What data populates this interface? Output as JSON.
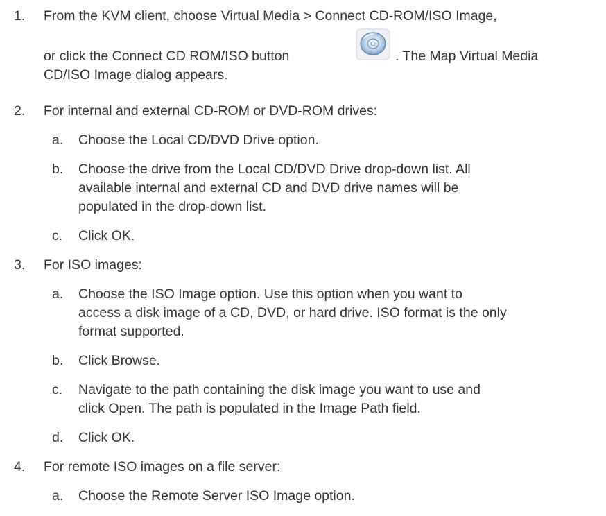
{
  "steps": [
    {
      "num": "1.",
      "line1": "From the KVM client, choose Virtual Media > Connect CD-ROM/ISO Image,",
      "line2": "or click the Connect CD ROM/ISO button",
      "line2_after": ". The Map Virtual Media",
      "line3": "CD/ISO Image dialog appears.",
      "icon": "cd-disc-icon"
    },
    {
      "num": "2.",
      "text": "For internal and external CD-ROM or DVD-ROM drives:",
      "subs": [
        {
          "letter": "a.",
          "lines": [
            "Choose the Local CD/DVD Drive option."
          ]
        },
        {
          "letter": "b.",
          "lines": [
            "Choose the drive from the Local CD/DVD Drive drop-down list. All",
            "available internal and external CD and DVD drive names will be",
            "populated in the drop-down list."
          ]
        },
        {
          "letter": "c.",
          "lines": [
            "Click OK."
          ]
        }
      ]
    },
    {
      "num": "3.",
      "text": "For ISO images:",
      "subs": [
        {
          "letter": "a.",
          "lines": [
            "Choose the ISO Image option. Use this option when you want to",
            "access a disk image of a CD, DVD, or hard drive. ISO format is the only",
            "format supported."
          ]
        },
        {
          "letter": "b.",
          "lines": [
            "Click Browse."
          ]
        },
        {
          "letter": "c.",
          "lines": [
            "Navigate to the path containing the disk image you want to use and",
            "click Open. The path is populated in the Image Path field."
          ]
        },
        {
          "letter": "d.",
          "lines": [
            "Click OK."
          ]
        }
      ]
    },
    {
      "num": "4.",
      "text": "For remote ISO images on a file server:",
      "subs": [
        {
          "letter": "a.",
          "lines": [
            "Choose the Remote Server ISO Image option."
          ]
        }
      ]
    }
  ]
}
